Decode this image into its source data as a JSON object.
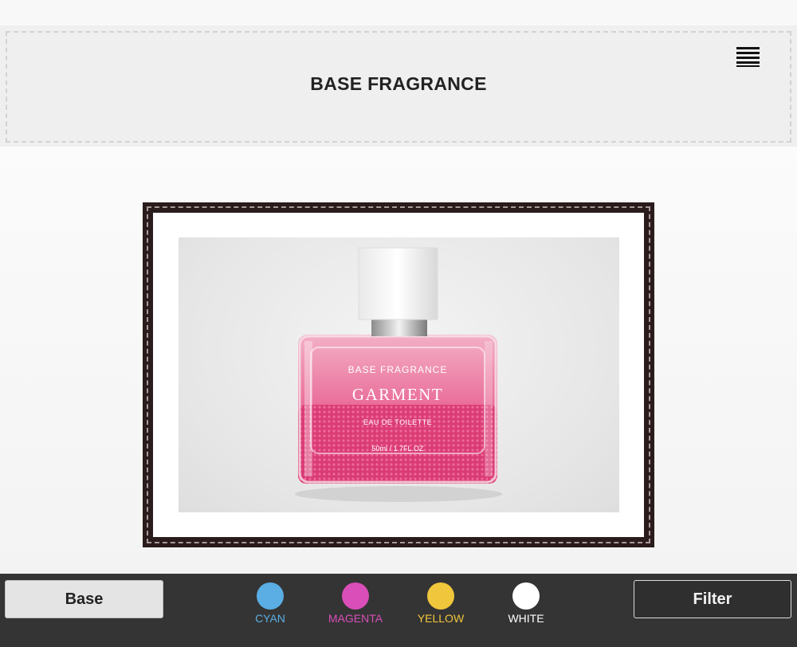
{
  "header": {
    "title": "BASE FRAGRANCE",
    "menu_icon": "hamburger-menu-icon"
  },
  "product": {
    "label_brand": "BASE FRAGRANCE",
    "label_name": "GARMENT",
    "label_type": "EAU DE TOILETTE",
    "label_volume": "50ml / 1.7FL.OZ"
  },
  "toolbar": {
    "base_label": "Base",
    "filter_label": "Filter",
    "swatches": [
      {
        "label": "CYAN",
        "color": "#5aaee3"
      },
      {
        "label": "MAGENTA",
        "color": "#d94eb8"
      },
      {
        "label": "YELLOW",
        "color": "#f0c73c"
      },
      {
        "label": "WHITE",
        "color": "#ffffff"
      }
    ]
  },
  "colors": {
    "bottom_bar": "#343434",
    "frame": "#2a1c1c",
    "bottle_pink": "#e0457e"
  }
}
